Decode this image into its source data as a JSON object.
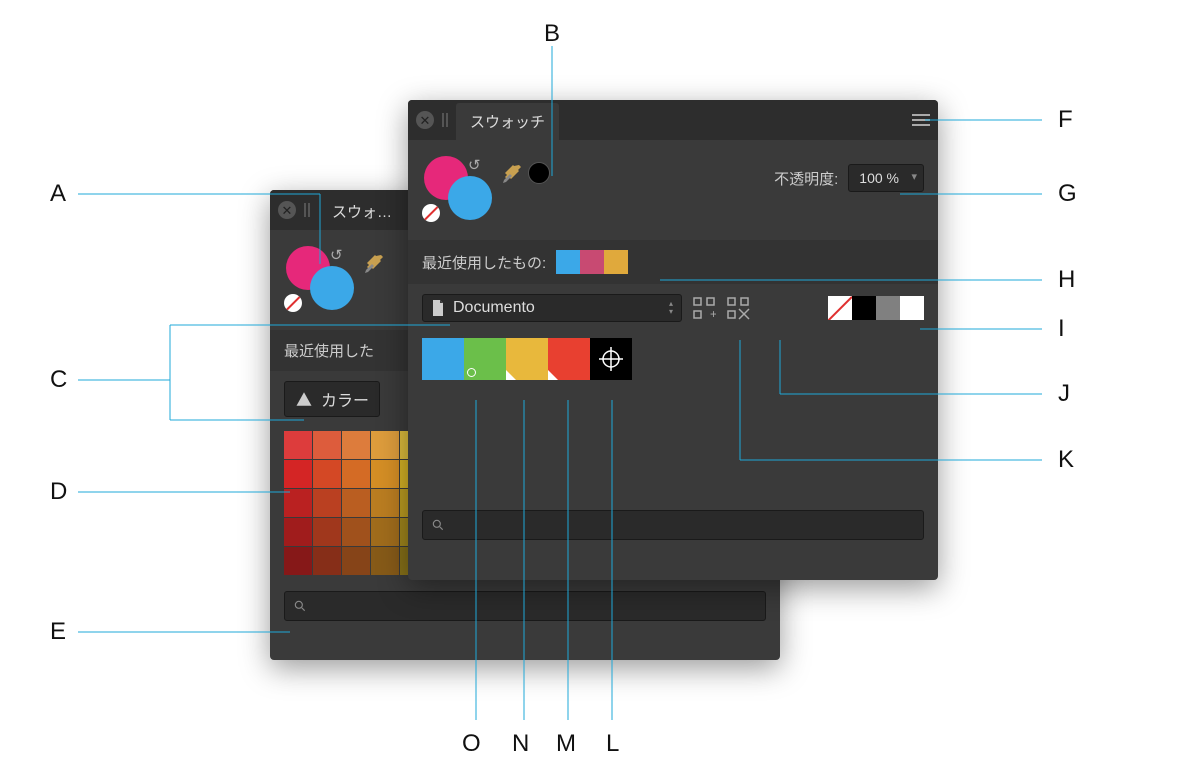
{
  "panels": {
    "front": {
      "title": "スウォッチ"
    },
    "back": {
      "title": "スウォ…"
    }
  },
  "opacity": {
    "label": "不透明度:",
    "value": "100 %"
  },
  "recent": {
    "label": "最近使用したもの:",
    "label_back": "最近使用した",
    "colors": [
      "#3ba8e8",
      "#c84a72",
      "#e0a93c"
    ]
  },
  "palette_select": {
    "value": "Documento"
  },
  "palette_back_label": "カラー",
  "base_colors": {
    "none": true,
    "colors": [
      "#000000",
      "#808080",
      "#ffffff"
    ]
  },
  "swatches": [
    {
      "color": "#3ba8e8",
      "marker": "none"
    },
    {
      "color": "#6bbf4a",
      "marker": "dot"
    },
    {
      "color": "#e8b83c",
      "marker": "triangle"
    },
    {
      "color": "#e84030",
      "marker": "triangle"
    },
    {
      "color": "#000000",
      "marker": "register"
    }
  ],
  "callouts": {
    "A": "A",
    "B": "B",
    "C": "C",
    "D": "D",
    "E": "E",
    "F": "F",
    "G": "G",
    "H": "H",
    "I": "I",
    "J": "J",
    "K": "K",
    "L": "L",
    "M": "M",
    "N": "N",
    "O": "O"
  }
}
